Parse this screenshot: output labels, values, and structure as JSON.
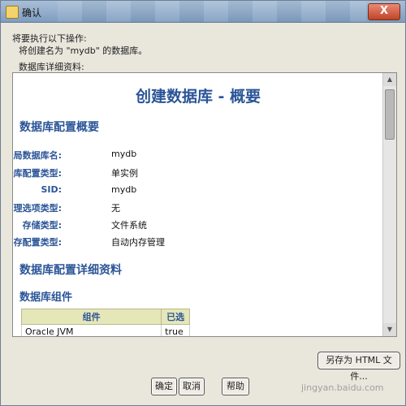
{
  "window": {
    "title": "确认",
    "close_glyph": "X"
  },
  "intro": {
    "line1": "将要执行以下操作:",
    "line2": "将创建名为 \"mydb\" 的数据库。"
  },
  "details_label": "数据库详细资料:",
  "summary": {
    "title": "创建数据库 - 概要",
    "section1": "数据库配置概要",
    "fields": [
      {
        "label": "全局数据库名:",
        "value": "mydb"
      },
      {
        "label": "数据库配置类型:",
        "value": "单实例"
      },
      {
        "label": "SID:",
        "value": "mydb"
      },
      {
        "label": "管理选项类型:",
        "value": "无"
      },
      {
        "label": "存储类型:",
        "value": "文件系统"
      },
      {
        "label": "内存配置类型:",
        "value": "自动内存管理"
      }
    ],
    "section2": "数据库配置详细资料",
    "section3": "数据库组件",
    "table": {
      "headers": [
        "组件",
        "已选"
      ],
      "rows": [
        [
          "Oracle JVM",
          "true"
        ]
      ]
    }
  },
  "buttons": {
    "save_html": "另存为 HTML 文件...",
    "ok": "确定",
    "cancel": "取消",
    "help": "帮助"
  },
  "watermark": "jingyan.baidu.com"
}
